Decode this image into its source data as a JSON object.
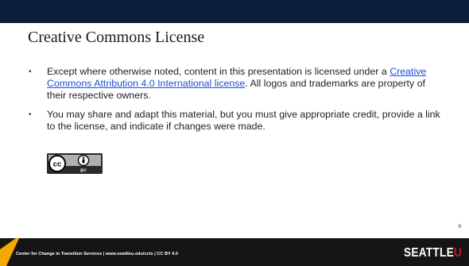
{
  "slide": {
    "title": "Creative Commons License",
    "bullets": [
      {
        "pre": "Except where otherwise noted, content in this presentation is licensed under a ",
        "link": "Creative Commons Attribution 4.0 International license",
        "post": ". All logos and trademarks are property of their respective owners."
      },
      {
        "text": "You may share and adapt this material, but you must give appropriate credit, provide a link to the license, and indicate if changes were made."
      }
    ],
    "bullet_glyph": "•",
    "cc_badge": {
      "cc_text": "cc",
      "by_text": "BY",
      "icon_names": [
        "cc-icon",
        "attribution-icon"
      ]
    },
    "slide_number": "9"
  },
  "footer": {
    "text": "Center for Change in Transition Services | www.seattleu.edu/ccts | CC BY 4.0",
    "logo_main": "SEATTLE",
    "logo_accent": "U"
  },
  "colors": {
    "top_band": "#0b1f3a",
    "footer_bg": "#151515",
    "footer_accent": "#f2a900",
    "link": "#1a4fd6",
    "logo_accent": "#c8102e"
  }
}
